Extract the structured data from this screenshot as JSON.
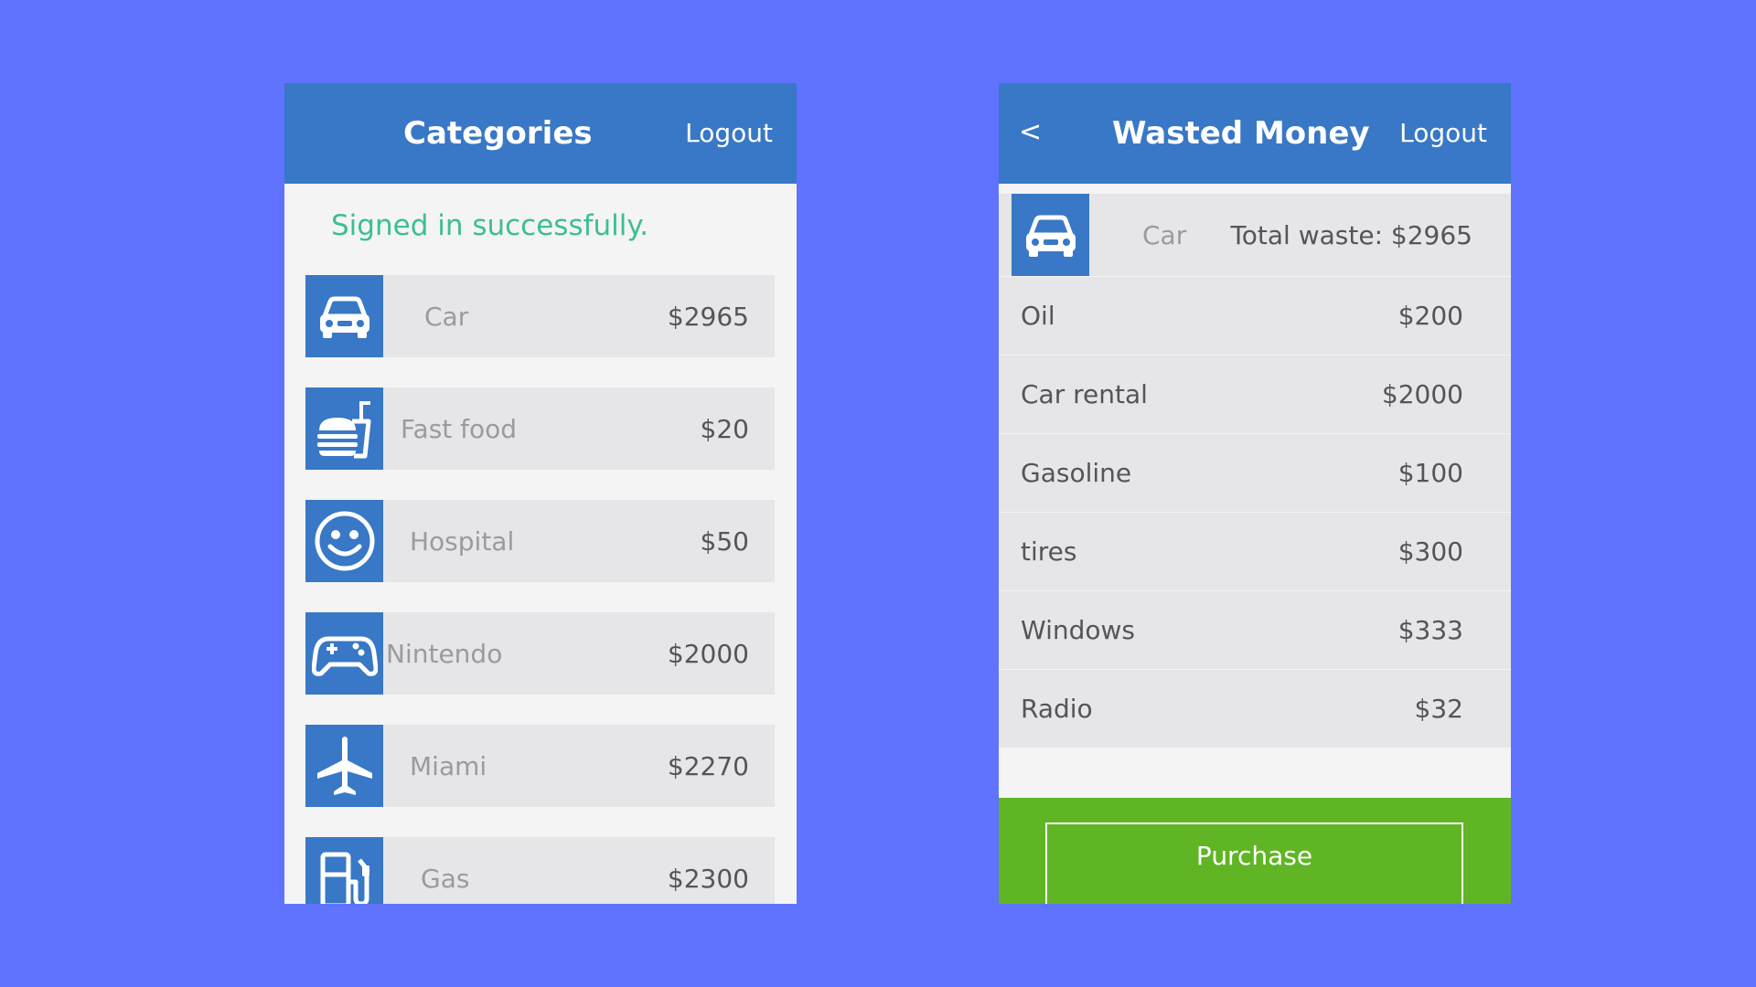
{
  "colors": {
    "background": "#5f73fe",
    "header": "#3878c6",
    "panel": "#f4f4f5",
    "row": "#e6e6e8",
    "success_text": "#3dbf8e",
    "purchase_bar": "#60b524"
  },
  "left": {
    "header": {
      "title": "Categories",
      "logout": "Logout"
    },
    "flash": "Signed in successfully.",
    "categories": [
      {
        "icon": "car-icon",
        "name": "Car",
        "amount": "$2965"
      },
      {
        "icon": "fast-food-icon",
        "name": "Fast food",
        "amount": "$20"
      },
      {
        "icon": "smiley-icon",
        "name": "Hospital",
        "amount": "$50"
      },
      {
        "icon": "gamepad-icon",
        "name": "Nintendo",
        "amount": "$2000"
      },
      {
        "icon": "airplane-icon",
        "name": "Miami",
        "amount": "$2270"
      },
      {
        "icon": "gas-pump-icon",
        "name": "Gas",
        "amount": "$2300"
      }
    ]
  },
  "right": {
    "header": {
      "back": "<",
      "title": "Wasted Money",
      "logout": "Logout"
    },
    "summary": {
      "icon": "car-icon",
      "name": "Car",
      "total": "Total waste: $2965"
    },
    "expenses": [
      {
        "name": "Oil",
        "amount": "$200"
      },
      {
        "name": "Car rental",
        "amount": "$2000"
      },
      {
        "name": "Gasoline",
        "amount": "$100"
      },
      {
        "name": "tires",
        "amount": "$300"
      },
      {
        "name": "Windows",
        "amount": "$333"
      },
      {
        "name": "Radio",
        "amount": "$32"
      }
    ],
    "purchase_label": "Purchase"
  }
}
